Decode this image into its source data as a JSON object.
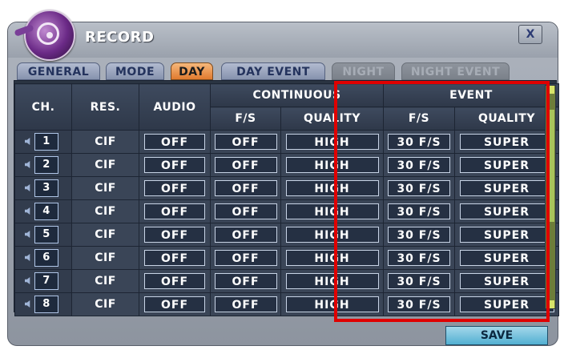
{
  "window": {
    "title": "RECORD",
    "close_label": "X"
  },
  "tabs": [
    {
      "label": "GENERAL",
      "state": "normal"
    },
    {
      "label": "MODE",
      "state": "normal"
    },
    {
      "label": "DAY",
      "state": "active"
    },
    {
      "label": "DAY EVENT",
      "state": "normal"
    },
    {
      "label": "NIGHT",
      "state": "disabled"
    },
    {
      "label": "NIGHT EVENT",
      "state": "disabled"
    }
  ],
  "table": {
    "headers": {
      "ch": "CH.",
      "res": "RES.",
      "audio": "AUDIO",
      "continuous": "CONTINUOUS",
      "event": "EVENT",
      "cont_fs": "F/S",
      "cont_quality": "QUALITY",
      "event_fs": "F/S",
      "event_quality": "QUALITY"
    },
    "rows": [
      {
        "ch": "1",
        "res": "CIF",
        "audio": "OFF",
        "cont_fs": "OFF",
        "cont_quality": "HIGH",
        "event_fs": "30 F/S",
        "event_quality": "SUPER"
      },
      {
        "ch": "2",
        "res": "CIF",
        "audio": "OFF",
        "cont_fs": "OFF",
        "cont_quality": "HIGH",
        "event_fs": "30 F/S",
        "event_quality": "SUPER"
      },
      {
        "ch": "3",
        "res": "CIF",
        "audio": "OFF",
        "cont_fs": "OFF",
        "cont_quality": "HIGH",
        "event_fs": "30 F/S",
        "event_quality": "SUPER"
      },
      {
        "ch": "4",
        "res": "CIF",
        "audio": "OFF",
        "cont_fs": "OFF",
        "cont_quality": "HIGH",
        "event_fs": "30 F/S",
        "event_quality": "SUPER"
      },
      {
        "ch": "5",
        "res": "CIF",
        "audio": "OFF",
        "cont_fs": "OFF",
        "cont_quality": "HIGH",
        "event_fs": "30 F/S",
        "event_quality": "SUPER"
      },
      {
        "ch": "6",
        "res": "CIF",
        "audio": "OFF",
        "cont_fs": "OFF",
        "cont_quality": "HIGH",
        "event_fs": "30 F/S",
        "event_quality": "SUPER"
      },
      {
        "ch": "7",
        "res": "CIF",
        "audio": "OFF",
        "cont_fs": "OFF",
        "cont_quality": "HIGH",
        "event_fs": "30 F/S",
        "event_quality": "SUPER"
      },
      {
        "ch": "8",
        "res": "CIF",
        "audio": "OFF",
        "cont_fs": "OFF",
        "cont_quality": "HIGH",
        "event_fs": "30 F/S",
        "event_quality": "SUPER"
      }
    ]
  },
  "footer": {
    "save_label": "SAVE"
  },
  "icons": {
    "logo": "disc-logo-icon",
    "speaker": "speaker-icon",
    "close": "close-icon"
  },
  "colors": {
    "highlight": "#e00000",
    "active_tab": "#e07a2e",
    "save": "#52b0d2"
  }
}
